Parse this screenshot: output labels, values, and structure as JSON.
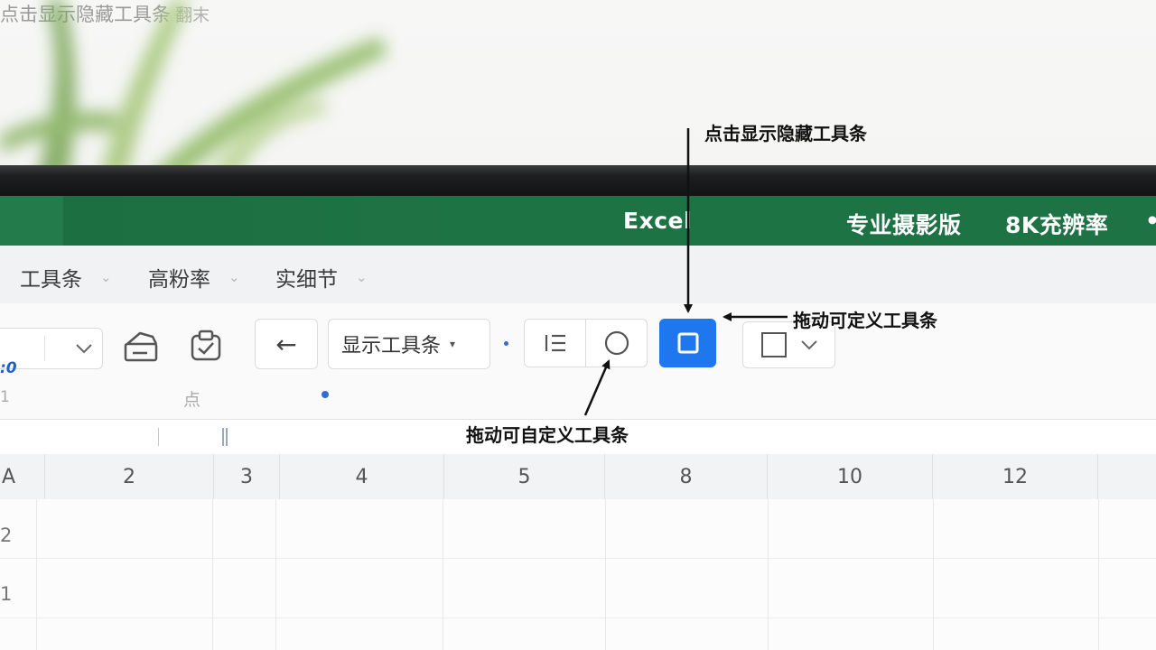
{
  "titlebar": {
    "app": "Excel",
    "tag1": "专业摄影版",
    "tag2": "8K充辨率"
  },
  "menu": {
    "items": [
      "工具条",
      "高粉率",
      "实细节"
    ]
  },
  "ribbon": {
    "partial_value": ":0",
    "partial_sub": "1",
    "back_label": "←",
    "show_toolbar_label": "显示工具条",
    "group_label_1": "点",
    "hint": "点击显示隐藏工具条",
    "group_label_2": "翻末"
  },
  "grid": {
    "columns": [
      "A",
      "2",
      "3",
      "4",
      "5",
      "8",
      "10",
      "12"
    ],
    "rows": [
      "2",
      "1"
    ]
  },
  "annotations": {
    "top": "点击显示隐藏工具条",
    "right": "拖动可定义工具条",
    "bottom": "拖动可自定义工具条"
  },
  "colors": {
    "titlebar_green": "#1e7345",
    "accent_blue": "#1f77ef"
  }
}
